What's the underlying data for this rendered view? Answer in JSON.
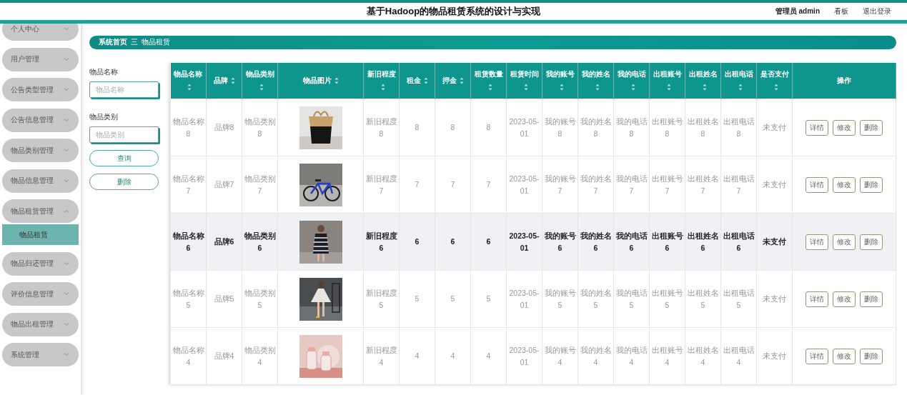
{
  "header": {
    "title": "基于Hadoop的物品租赁系统的设计与实现",
    "user": "管理员 admin",
    "links": [
      "看板",
      "退出登录"
    ]
  },
  "sidebar": {
    "items": [
      {
        "label": "个人中心",
        "expanded": false
      },
      {
        "label": "用户管理",
        "expanded": false
      },
      {
        "label": "公告类型管理",
        "expanded": false
      },
      {
        "label": "公告信息管理",
        "expanded": false
      },
      {
        "label": "物品类别管理",
        "expanded": false
      },
      {
        "label": "物品信息管理",
        "expanded": false
      },
      {
        "label": "物品租赁管理",
        "expanded": true,
        "children": [
          {
            "label": "物品租赁",
            "selected": true
          }
        ]
      },
      {
        "label": "物品归还管理",
        "expanded": false
      },
      {
        "label": "评价信息管理",
        "expanded": false
      },
      {
        "label": "物品出租管理",
        "expanded": false
      },
      {
        "label": "系统管理",
        "expanded": false
      }
    ]
  },
  "breadcrumb": {
    "items": [
      "系统首页",
      "物品租赁"
    ],
    "separator": "三"
  },
  "search": {
    "fields": [
      {
        "label": "物品名称",
        "placeholder": "物品名称"
      },
      {
        "label": "物品类别",
        "placeholder": "物品类别"
      }
    ],
    "buttons": [
      "查询",
      "删除"
    ]
  },
  "table": {
    "columns": [
      {
        "label": "物品名称",
        "kind": "text",
        "sortable": true
      },
      {
        "label": "品牌",
        "kind": "text",
        "sortable": true
      },
      {
        "label": "物品类别",
        "kind": "text",
        "sortable": true
      },
      {
        "label": "物品图片",
        "kind": "picture",
        "sortable": true
      },
      {
        "label": "新旧程度",
        "kind": "text",
        "sortable": true
      },
      {
        "label": "租金",
        "kind": "text",
        "sortable": true
      },
      {
        "label": "押金",
        "kind": "text",
        "sortable": true
      },
      {
        "label": "租赁数量",
        "kind": "text",
        "sortable": true
      },
      {
        "label": "租赁时间",
        "kind": "text",
        "sortable": true
      },
      {
        "label": "我的账号",
        "kind": "text",
        "sortable": true
      },
      {
        "label": "我的姓名",
        "kind": "text",
        "sortable": true
      },
      {
        "label": "我的电话",
        "kind": "text",
        "sortable": true
      },
      {
        "label": "出租账号",
        "kind": "text",
        "sortable": true
      },
      {
        "label": "出租姓名",
        "kind": "text",
        "sortable": true
      },
      {
        "label": "出租电话",
        "kind": "text",
        "sortable": true
      },
      {
        "label": "是否支付",
        "kind": "text",
        "sortable": true
      },
      {
        "label": "操作",
        "kind": "actions",
        "sortable": false
      }
    ],
    "rows": [
      {
        "highlighted": false,
        "cells": [
          "物品名称8",
          "品牌8",
          "物品类别8",
          {
            "kind": "picture"
          },
          "新旧程度8",
          "8",
          "8",
          "8",
          "2023-05-01",
          "我的账号8",
          "我的姓名8",
          "我的电话8",
          "出租账号8",
          "出租姓名8",
          "出租电话8",
          "未支付",
          [
            "详情",
            "修改",
            "删除"
          ]
        ]
      },
      {
        "highlighted": false,
        "cells": [
          "物品名称7",
          "品牌7",
          "物品类别7",
          {
            "kind": "picture"
          },
          "新旧程度7",
          "7",
          "7",
          "7",
          "2023-05-01",
          "我的账号7",
          "我的姓名7",
          "我的电话7",
          "出租账号7",
          "出租姓名7",
          "出租电话7",
          "未支付",
          [
            "详情",
            "修改",
            "删除"
          ]
        ]
      },
      {
        "highlighted": true,
        "cells": [
          "物品名称6",
          "品牌6",
          "物品类别6",
          {
            "kind": "picture"
          },
          "新旧程度6",
          "6",
          "6",
          "6",
          "2023-05-01",
          "我的账号6",
          "我的姓名6",
          "我的电话6",
          "出租账号6",
          "出租姓名6",
          "出租电话6",
          "未支付",
          [
            "详情",
            "修改",
            "删除"
          ]
        ]
      },
      {
        "highlighted": false,
        "cells": [
          "物品名称5",
          "品牌5",
          "物品类别5",
          {
            "kind": "picture"
          },
          "新旧程度5",
          "5",
          "5",
          "5",
          "2023-05-01",
          "我的账号5",
          "我的姓名5",
          "我的电话5",
          "出租账号5",
          "出租姓名5",
          "出租电话5",
          "未支付",
          [
            "详情",
            "修改",
            "删除"
          ]
        ]
      },
      {
        "highlighted": false,
        "cells": [
          "物品名称4",
          "品牌4",
          "物品类别4",
          {
            "kind": "picture"
          },
          "新旧程度4",
          "4",
          "4",
          "4",
          "2023-05-01",
          "我的账号4",
          "我的姓名4",
          "我的电话4",
          "出租账号4",
          "出租姓名4",
          "出租电话4",
          "未支付",
          [
            "详情",
            "修改",
            "删除"
          ]
        ]
      }
    ]
  }
}
